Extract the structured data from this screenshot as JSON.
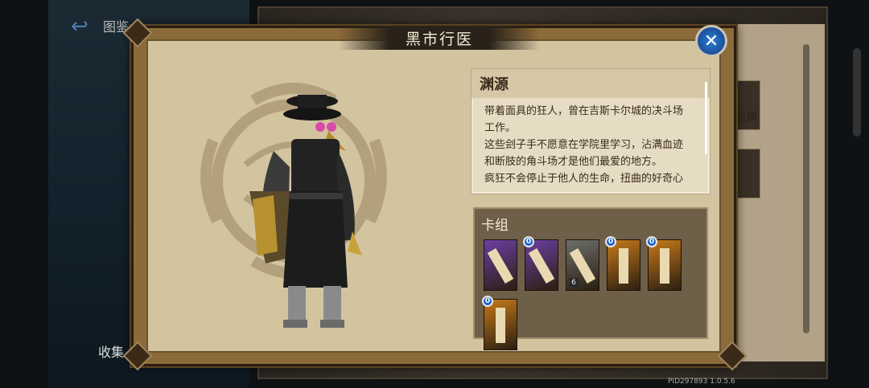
{
  "background": {
    "left_label": "收集",
    "tab_label": "图鉴",
    "right_name_fragment": "拉姆",
    "version": "PID297893  1.0.5.6"
  },
  "modal": {
    "title": "黑市行医",
    "lore": {
      "heading": "渊源",
      "text": "带着面具的狂人，曾在吉斯卡尔城的决斗场工作。\n这些刽子手不愿意在学院里学习，沾满血迹和断肢的角斗场才是他们最爱的地方。\n疯狂不会停止于他人的生命，扭曲的好奇心最终指向了他们自己。"
    },
    "deck": {
      "heading": "卡组",
      "cards": [
        {
          "name": "weapon-card",
          "color": "#6b3fa0",
          "cost": null,
          "count": null
        },
        {
          "name": "armor-card",
          "color": "#6b3fa0",
          "cost": "0",
          "count": null
        },
        {
          "name": "shield-card",
          "color": "#6d6f6a",
          "cost": null,
          "count": "6"
        },
        {
          "name": "light-sword-card",
          "color": "#c77a1a",
          "cost": "0",
          "count": null
        },
        {
          "name": "light-sword-card-2",
          "color": "#c77a1a",
          "cost": "0",
          "count": null
        },
        {
          "name": "light-sword-card-3",
          "color": "#c77a1a",
          "cost": "0",
          "count": null
        }
      ]
    }
  },
  "icons": {
    "close": "close-icon",
    "back": "back-arrow-icon"
  },
  "colors": {
    "close_button": "#1a4f9a",
    "parchment": "#d3c4a0",
    "deck_bg": "#6e5f49"
  }
}
